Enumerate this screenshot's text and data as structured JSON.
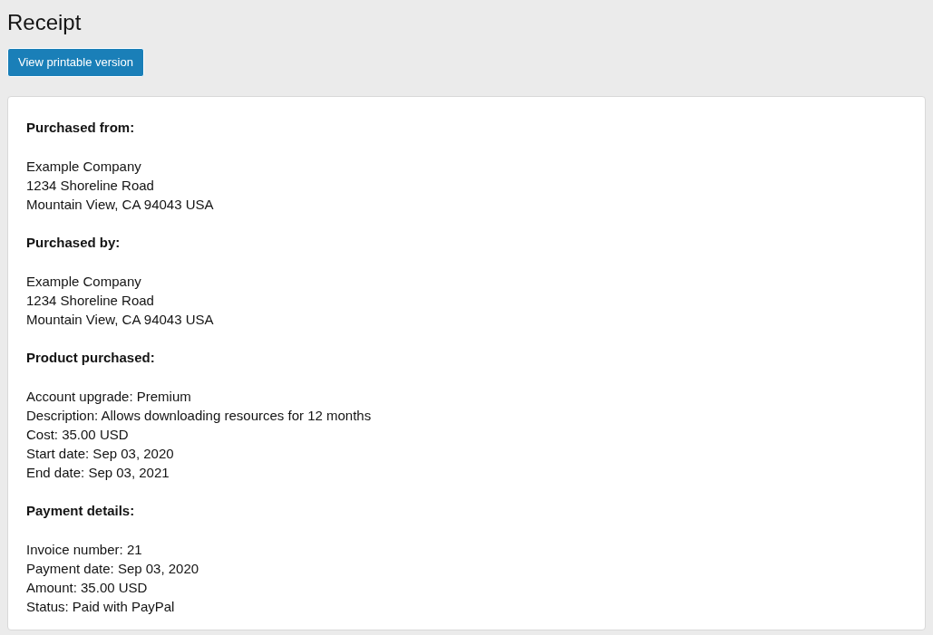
{
  "title": "Receipt",
  "print_button": {
    "label": "View printable version"
  },
  "sections": [
    {
      "heading": "Purchased from:",
      "lines": [
        "Example Company",
        "1234 Shoreline Road",
        "Mountain View, CA 94043 USA"
      ]
    },
    {
      "heading": "Purchased by:",
      "lines": [
        "Example Company",
        "1234 Shoreline Road",
        "Mountain View, CA 94043 USA"
      ]
    },
    {
      "heading": "Product purchased:",
      "lines": [
        "Account upgrade: Premium",
        "Description: Allows downloading resources for 12 months",
        "Cost: 35.00 USD",
        "Start date: Sep 03, 2020",
        "End date: Sep 03, 2021"
      ]
    },
    {
      "heading": "Payment details:",
      "lines": [
        "Invoice number: 21",
        "Payment date: Sep 03, 2020",
        "Amount: 35.00 USD",
        "Status: Paid with PayPal"
      ]
    }
  ]
}
